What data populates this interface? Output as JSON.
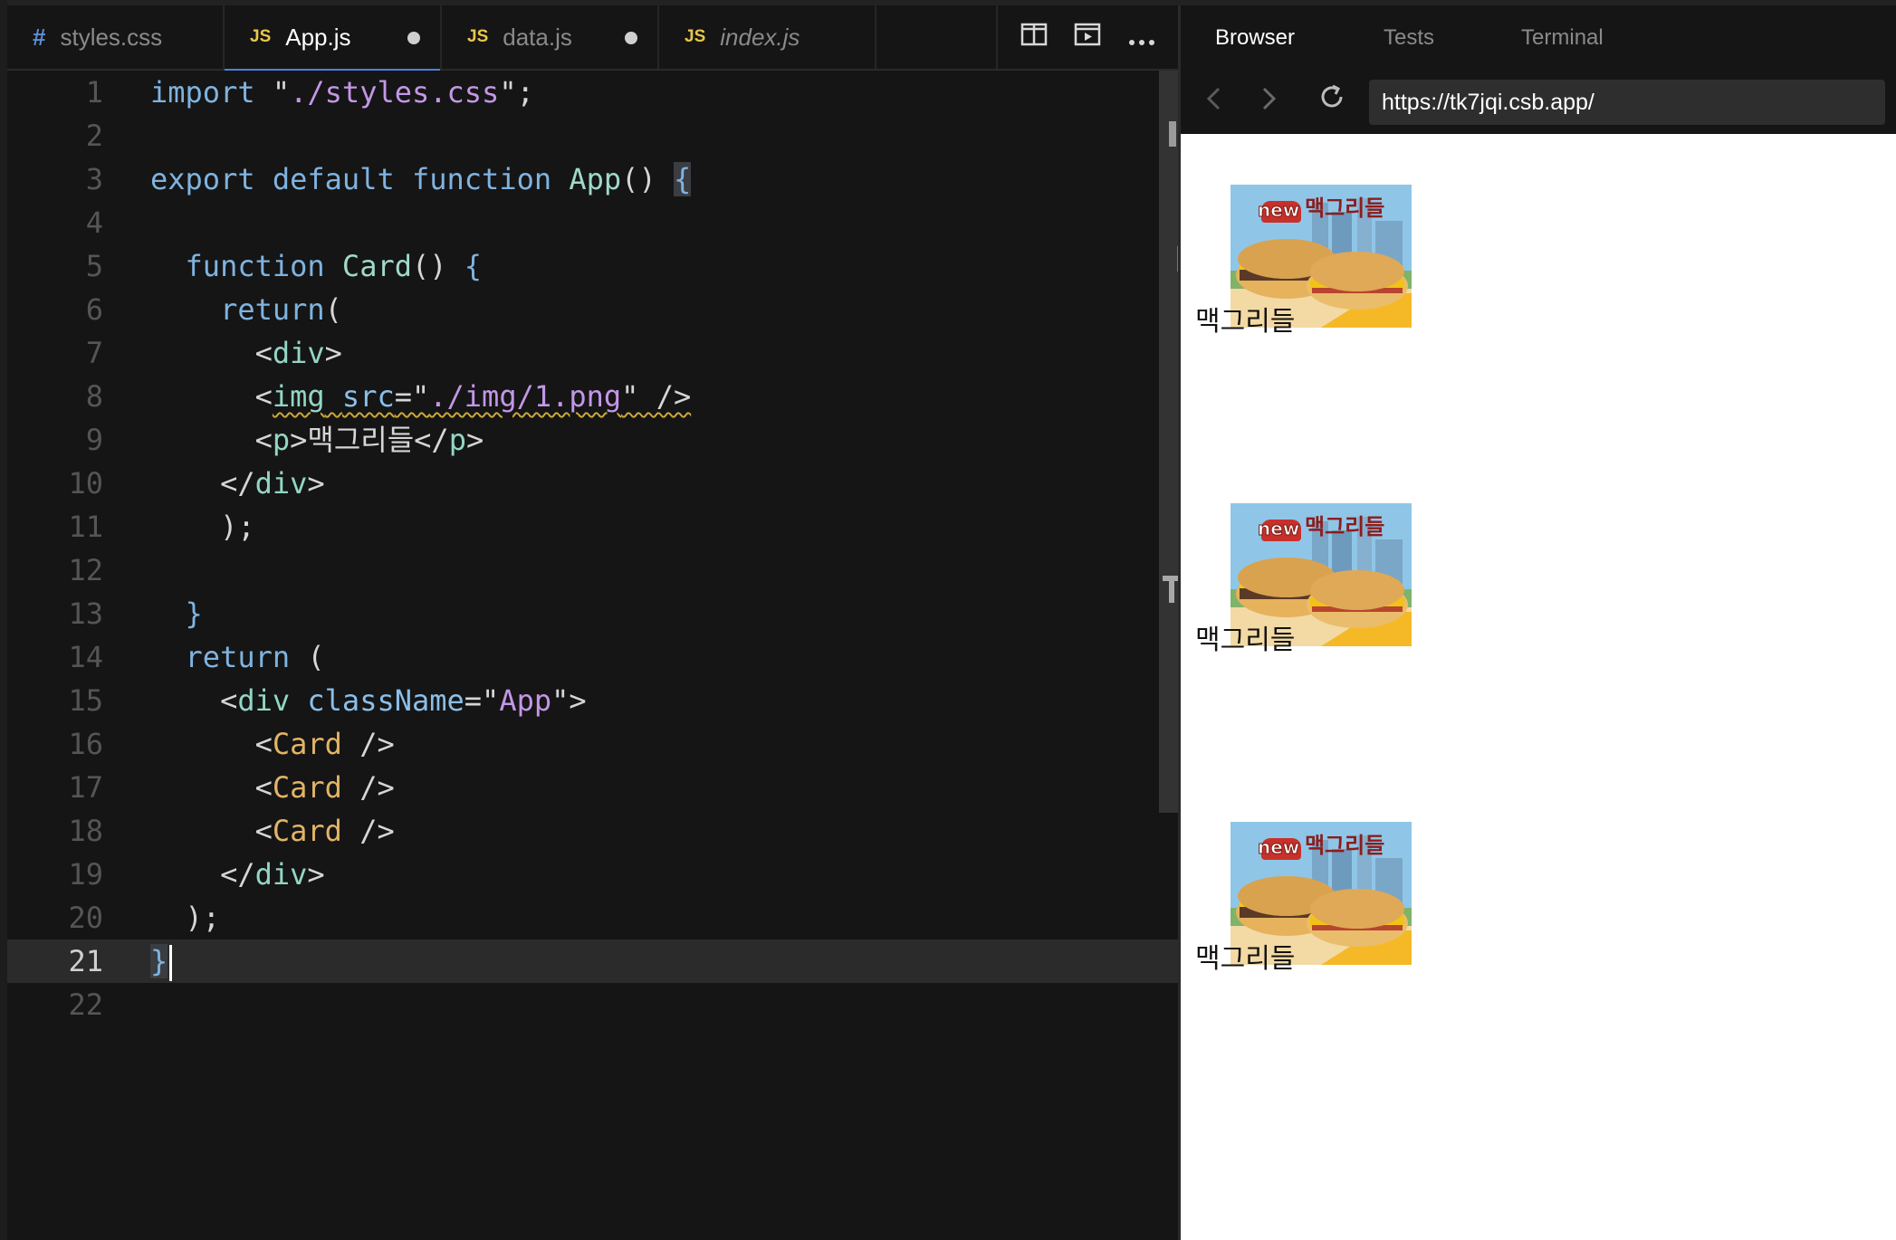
{
  "editor": {
    "tabs": [
      {
        "ext": "#",
        "name": "styles.css"
      },
      {
        "ext": "JS",
        "name": "App.js"
      },
      {
        "ext": "JS",
        "name": "data.js"
      },
      {
        "ext": "JS",
        "name": "index.js"
      }
    ],
    "actions": [
      "split-editor-icon",
      "preview-icon",
      "more-icon"
    ],
    "line_numbers": [
      "1",
      "2",
      "3",
      "4",
      "5",
      "6",
      "7",
      "8",
      "9",
      "10",
      "11",
      "12",
      "13",
      "14",
      "15",
      "16",
      "17",
      "18",
      "19",
      "20",
      "21",
      "22"
    ],
    "code": {
      "l1": {
        "a": "import",
        "b": " \"",
        "c": "./styles.css",
        "d": "\";"
      },
      "l3": {
        "a": "export default function",
        "b": " App",
        "c": "() ",
        "d": "{"
      },
      "l5": {
        "a": "  function",
        "b": " Card",
        "c": "() ",
        "d": "{"
      },
      "l6": {
        "a": "    return",
        "b": "("
      },
      "l7": {
        "a": "      <",
        "b": "div",
        "c": ">"
      },
      "l8": {
        "a": "      <",
        "b": "img",
        "c": " ",
        "d": "src",
        "e": "=\"",
        "f": "./img/1.png",
        "g": "\" />"
      },
      "l9": {
        "a": "      <",
        "b": "p",
        "c": ">맥그리들</",
        "d": "p",
        "e": ">"
      },
      "l10": {
        "a": "    </",
        "b": "div",
        "c": ">"
      },
      "l11": {
        "a": "    );"
      },
      "l13": {
        "a": "  }"
      },
      "l14": {
        "a": "  return",
        "b": " ("
      },
      "l15": {
        "a": "    <",
        "b": "div",
        "c": " ",
        "d": "className",
        "e": "=\"",
        "f": "App",
        "g": "\">"
      },
      "l16": {
        "a": "      <",
        "b": "Card",
        "c": " />"
      },
      "l17": {
        "a": "      <",
        "b": "Card",
        "c": " />"
      },
      "l18": {
        "a": "      <",
        "b": "Card",
        "c": " />"
      },
      "l19": {
        "a": "    </",
        "b": "div",
        "c": ">"
      },
      "l20": {
        "a": "  );"
      },
      "l21": {
        "a": "}"
      }
    }
  },
  "panel": {
    "tabs": [
      "Browser",
      "Tests",
      "Terminal"
    ],
    "url": "https://tk7jqi.csb.app/",
    "cards": [
      {
        "badge": "new",
        "image_title": "맥그리들",
        "text": "맥그리들"
      },
      {
        "badge": "new",
        "image_title": "맥그리들",
        "text": "맥그리들"
      },
      {
        "badge": "new",
        "image_title": "맥그리들",
        "text": "맥그리들"
      }
    ]
  },
  "colors": {
    "keyword": "#7fb3e0",
    "string": "#c397e6",
    "component": "#e3b466",
    "tag": "#93d6c5",
    "accent": "#4d80e4"
  }
}
